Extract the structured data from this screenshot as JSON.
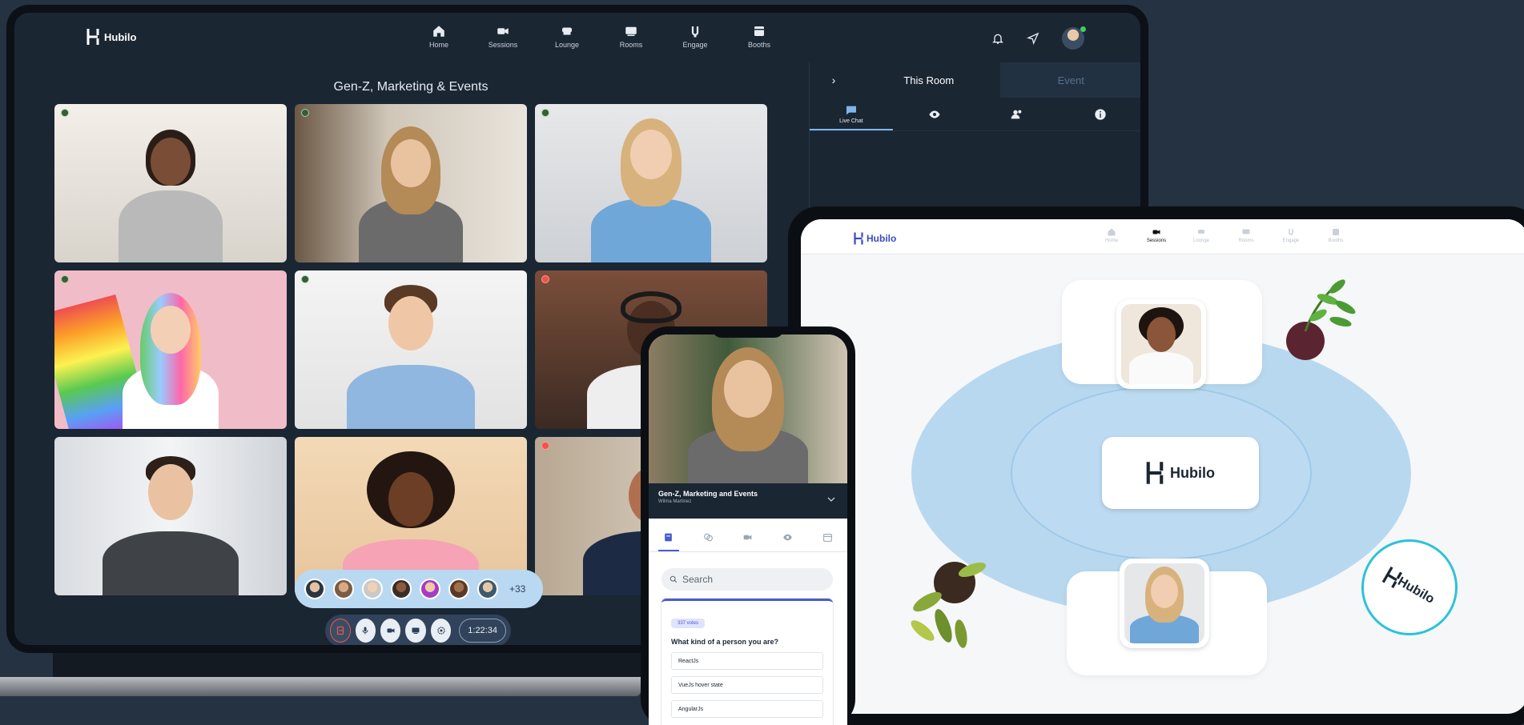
{
  "laptop": {
    "logo_text": "Hubilo",
    "nav": [
      {
        "label": "Home",
        "icon": "home-icon"
      },
      {
        "label": "Sessions",
        "icon": "video-icon"
      },
      {
        "label": "Lounge",
        "icon": "lounge-icon"
      },
      {
        "label": "Rooms",
        "icon": "rooms-icon"
      },
      {
        "label": "Engage",
        "icon": "engage-icon"
      },
      {
        "label": "Booths",
        "icon": "booth-icon"
      }
    ],
    "room_title": "Gen-Z, Marketing & Events",
    "participants_more": "+33",
    "timer": "1:22:34",
    "panel": {
      "toggle": "›",
      "tabs": [
        "This Room",
        "Event"
      ],
      "active_tab": "This Room",
      "icon_tabs": [
        {
          "label": "Live Chat",
          "icon": "chat-icon"
        },
        {
          "label": "",
          "icon": "eye-icon"
        },
        {
          "label": "",
          "icon": "people-icon"
        },
        {
          "label": "",
          "icon": "info-icon"
        }
      ]
    }
  },
  "tablet": {
    "logo_text": "Hubilo",
    "nav": [
      "Home",
      "Sessions",
      "Lounge",
      "Rooms",
      "Engage",
      "Booths"
    ],
    "active_nav": "Sessions",
    "center_logo": "Hubilo",
    "badge_text": "Hubilo"
  },
  "phone": {
    "session_title": "Gen-Z, Marketing and Events",
    "session_host": "Wilma Martinez",
    "search_placeholder": "Search",
    "poll": {
      "votes": "337 votes",
      "question": "What kind of a person you are?",
      "options": [
        "ReactJs",
        "VueJs hover state",
        "AngularJs"
      ]
    }
  }
}
